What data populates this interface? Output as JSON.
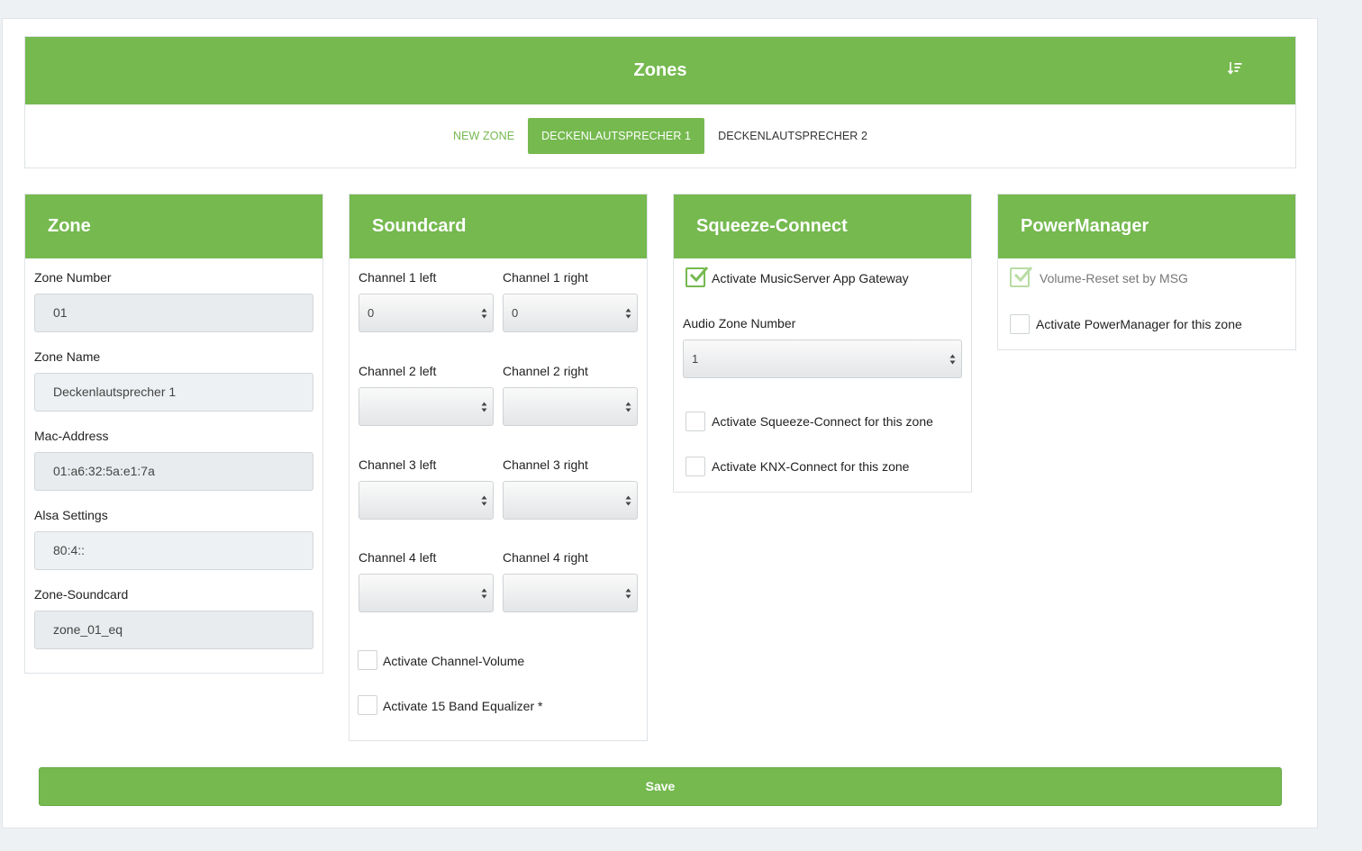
{
  "header": {
    "title": "Zones",
    "sort_icon": "sort-descending-icon"
  },
  "tabs": [
    {
      "label": "NEW ZONE"
    },
    {
      "label": "DECKENLAUTSPRECHER 1"
    },
    {
      "label": "DECKENLAUTSPRECHER 2"
    }
  ],
  "zone_panel": {
    "title": "Zone",
    "fields": [
      {
        "label": "Zone Number",
        "value": "01"
      },
      {
        "label": "Zone Name",
        "value": "Deckenlautsprecher 1"
      },
      {
        "label": "Mac-Address",
        "value": "01:a6:32:5a:e1:7a"
      },
      {
        "label": "Alsa Settings",
        "value": "80:4::"
      },
      {
        "label": "Zone-Soundcard",
        "value": "zone_01_eq"
      }
    ]
  },
  "soundcard_panel": {
    "title": "Soundcard",
    "channels": [
      {
        "left_label": "Channel 1 left",
        "left_value": "0",
        "right_label": "Channel 1 right",
        "right_value": "0"
      },
      {
        "left_label": "Channel 2 left",
        "left_value": "",
        "right_label": "Channel 2 right",
        "right_value": ""
      },
      {
        "left_label": "Channel 3 left",
        "left_value": "",
        "right_label": "Channel 3 right",
        "right_value": ""
      },
      {
        "left_label": "Channel 4 left",
        "left_value": "",
        "right_label": "Channel 4 right",
        "right_value": ""
      }
    ],
    "checkboxes": [
      {
        "label": "Activate Channel-Volume",
        "checked": false
      },
      {
        "label": "Activate 15 Band Equalizer *",
        "checked": false
      }
    ]
  },
  "squeeze_panel": {
    "title": "Squeeze-Connect",
    "gateway": {
      "label": "Activate MusicServer App Gateway",
      "checked": true
    },
    "audio_zone_label": "Audio Zone Number",
    "audio_zone_value": "1",
    "checkboxes": [
      {
        "label": "Activate Squeeze-Connect for this zone",
        "checked": false
      },
      {
        "label": "Activate KNX-Connect for this zone",
        "checked": false
      }
    ]
  },
  "power_panel": {
    "title": "PowerManager",
    "checkboxes": [
      {
        "label": "Volume-Reset set by MSG",
        "checked": true,
        "disabled": true
      },
      {
        "label": "Activate PowerManager for this zone",
        "checked": false
      }
    ]
  },
  "save_label": "Save",
  "colors": {
    "accent": "#75b94f",
    "background": "#eef1f4",
    "field_bg": "#e9ecee"
  }
}
